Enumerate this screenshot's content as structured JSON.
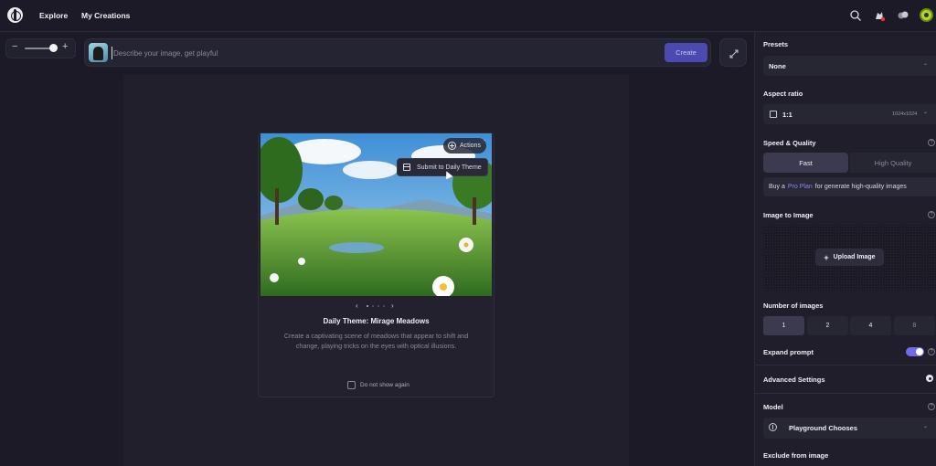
{
  "nav": {
    "explore": "Explore",
    "my_creations": "My Creations"
  },
  "toolbar": {
    "zoom_minus": "−",
    "zoom_plus": "+",
    "prompt_placeholder": "Describe your image, get playful",
    "create_label": "Create"
  },
  "card": {
    "actions_label": "Actions",
    "close_label": "×",
    "submit_label": "Submit to Daily Theme",
    "pager_prev": "‹",
    "pager_next": "›",
    "title": "Daily Theme: Mirage Meadows",
    "description": "Create a captivating scene of meadows that appear to shift and change, playing tricks on the eyes with optical illusions.",
    "dont_show_label": "Do not show again"
  },
  "panel": {
    "presets_label": "Presets",
    "presets_value": "None",
    "aspect_label": "Aspect ratio",
    "aspect_value": "1:1",
    "aspect_size": "1024x1024",
    "speed_label": "Speed & Quality",
    "speed_fast": "Fast",
    "speed_high": "High Quality",
    "info_pre": "Buy a",
    "info_link": "Pro Plan",
    "info_post": "for generate high-quality images",
    "i2i_label": "Image to Image",
    "upload_label": "Upload Image",
    "num_label": "Number of images",
    "num_options": [
      "1",
      "2",
      "4",
      "8"
    ],
    "expand_label": "Expand prompt",
    "advanced_label": "Advanced Settings",
    "model_label": "Model",
    "model_value": "Playground Chooses",
    "exclude_label": "Exclude from image",
    "help": "?",
    "chevron": "⌄"
  },
  "colors": {
    "accent": "#4c4ab0",
    "toggle": "#6e6ce8",
    "link": "#8a87f0",
    "background": "#1b1a26"
  }
}
